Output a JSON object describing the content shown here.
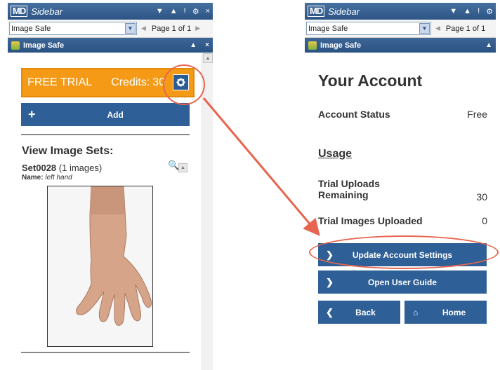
{
  "window": {
    "logo": "MD",
    "app_title": "Sidebar",
    "title_icons": [
      "▼",
      "▲",
      "!",
      "⚙",
      "×"
    ]
  },
  "selector": {
    "value": "Image Safe",
    "page_label": "Page 1 of 1"
  },
  "subpanel": {
    "title": "Image Safe",
    "icons": [
      "▲",
      "×"
    ]
  },
  "left": {
    "trial_label": "FREE TRIAL",
    "credits_label": "Credits:",
    "credits_value": "30",
    "add_label": "Add",
    "view_title": "View Image Sets:",
    "set_name": "Set0028",
    "set_count": "(1 images)",
    "name_prefix": "Name:",
    "name_value": "left hand"
  },
  "right": {
    "title": "Your Account",
    "account_status_label": "Account Status",
    "account_status_value": "Free",
    "usage_title": "Usage",
    "trial_uploads_label_1": "Trial Uploads",
    "trial_uploads_label_2": "Remaining",
    "trial_uploads_value": "30",
    "trial_images_label": "Trial Images Uploaded",
    "trial_images_value": "0",
    "update_button": "Update Account Settings",
    "guide_button": "Open User Guide",
    "back_button": "Back",
    "home_button": "Home"
  },
  "colors": {
    "titlebar": "#2c5586",
    "button_blue": "#2e5f96",
    "trial_orange": "#f59a16",
    "callout_red": "#e76550"
  }
}
